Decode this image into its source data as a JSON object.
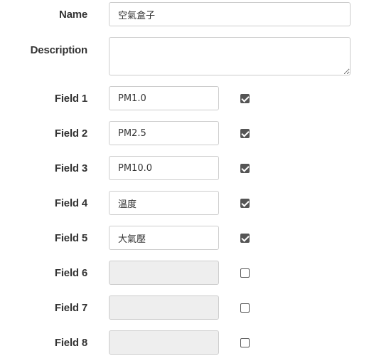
{
  "name_label": "Name",
  "name_value": "空氣盒子",
  "description_label": "Description",
  "description_value": "",
  "fields": [
    {
      "label": "Field 1",
      "value": "PM1.0",
      "checked": true,
      "enabled": true
    },
    {
      "label": "Field 2",
      "value": "PM2.5",
      "checked": true,
      "enabled": true
    },
    {
      "label": "Field 3",
      "value": "PM10.0",
      "checked": true,
      "enabled": true
    },
    {
      "label": "Field 4",
      "value": "溫度",
      "checked": true,
      "enabled": true
    },
    {
      "label": "Field 5",
      "value": "大氣壓",
      "checked": true,
      "enabled": true
    },
    {
      "label": "Field 6",
      "value": "",
      "checked": false,
      "enabled": false
    },
    {
      "label": "Field 7",
      "value": "",
      "checked": false,
      "enabled": false
    },
    {
      "label": "Field 8",
      "value": "",
      "checked": false,
      "enabled": false
    }
  ],
  "colors": {
    "checkbox": "#555555",
    "disabled_input": "#eeeeee",
    "border": "#cccccc"
  }
}
